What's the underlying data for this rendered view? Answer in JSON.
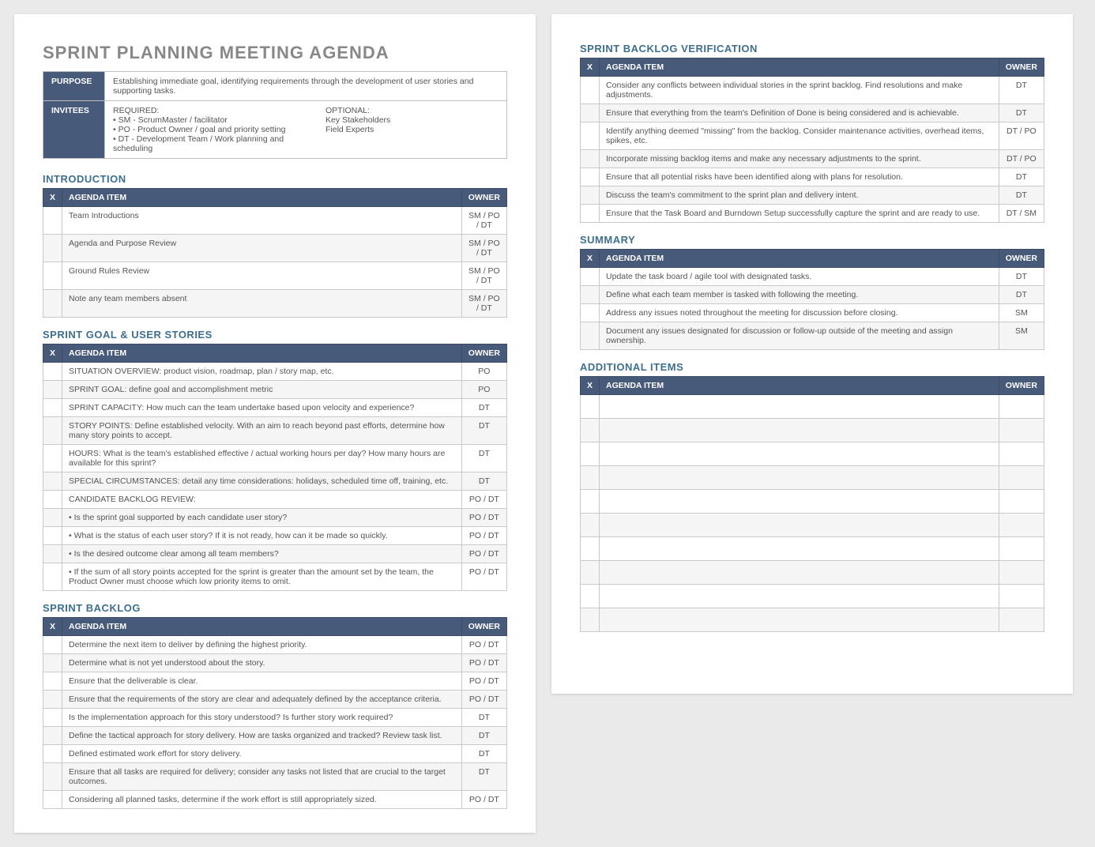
{
  "title": "SPRINT PLANNING MEETING AGENDA",
  "meta": {
    "purpose_label": "PURPOSE",
    "purpose_text": "Establishing immediate goal, identifying requirements through the development of user stories and supporting tasks.",
    "invitees_label": "INVITEES",
    "required_header": "REQUIRED:",
    "required_1": "• SM - ScrumMaster / facilitator",
    "required_2": "• PO - Product Owner / goal and priority setting",
    "required_3": "• DT - Development Team / Work planning and scheduling",
    "optional_header": "OPTIONAL:",
    "optional_1": "Key Stakeholders",
    "optional_2": "Field Experts"
  },
  "headers": {
    "x": "X",
    "item": "AGENDA ITEM",
    "owner": "OWNER"
  },
  "sections": {
    "introduction": {
      "title": "INTRODUCTION",
      "rows": [
        {
          "item": "Team Introductions",
          "owner": "SM / PO / DT"
        },
        {
          "item": "Agenda and Purpose Review",
          "owner": "SM / PO / DT"
        },
        {
          "item": "Ground Rules Review",
          "owner": "SM / PO / DT"
        },
        {
          "item": "Note any team members absent",
          "owner": "SM / PO / DT"
        }
      ]
    },
    "goal": {
      "title": "SPRINT GOAL & USER STORIES",
      "rows": [
        {
          "item": "SITUATION OVERVIEW: product vision, roadmap, plan / story map, etc.",
          "owner": "PO"
        },
        {
          "item": "SPRINT GOAL: define goal and accomplishment metric",
          "owner": "PO"
        },
        {
          "item": "SPRINT CAPACITY: How much can the team undertake based upon velocity and experience?",
          "owner": "DT"
        },
        {
          "item": "STORY POINTS: Define established velocity. With an aim to reach beyond past efforts, determine how many story points to accept.",
          "owner": "DT"
        },
        {
          "item": "HOURS: What is the team's established effective / actual working hours per day? How many hours are available for this sprint?",
          "owner": "DT"
        },
        {
          "item": "SPECIAL CIRCUMSTANCES: detail any time considerations: holidays, scheduled time off, training, etc.",
          "owner": "DT"
        },
        {
          "item": "CANDIDATE BACKLOG REVIEW:",
          "owner": "PO / DT"
        },
        {
          "item": "• Is the sprint goal supported by each candidate user story?",
          "owner": "PO / DT"
        },
        {
          "item": "• What is the status of each user story? If it is not ready, how can it be made so quickly.",
          "owner": "PO / DT"
        },
        {
          "item": "• Is the desired outcome clear among all team members?",
          "owner": "PO / DT"
        },
        {
          "item": "• If the sum of all story points accepted for the sprint is greater than the amount set by the team, the Product Owner must choose which low priority items to omit.",
          "owner": "PO / DT"
        }
      ]
    },
    "backlog": {
      "title": "SPRINT BACKLOG",
      "rows": [
        {
          "item": "Determine the next item to deliver by defining the highest priority.",
          "owner": "PO / DT"
        },
        {
          "item": "Determine what is not yet understood about the story.",
          "owner": "PO / DT"
        },
        {
          "item": "Ensure that the deliverable is clear.",
          "owner": "PO / DT"
        },
        {
          "item": "Ensure that the requirements of the story are clear and adequately defined by the acceptance criteria.",
          "owner": "PO / DT"
        },
        {
          "item": "Is the implementation approach for this story understood?  Is further story work required?",
          "owner": "DT"
        },
        {
          "item": "Define the tactical approach for story delivery.  How are tasks organized and tracked? Review task list.",
          "owner": "DT"
        },
        {
          "item": "Defined estimated work effort for story delivery.",
          "owner": "DT"
        },
        {
          "item": "Ensure that all tasks are required for delivery; consider any tasks not listed that are crucial to the target outcomes.",
          "owner": "DT"
        },
        {
          "item": "Considering all planned tasks, determine if the work effort is still appropriately sized.",
          "owner": "PO / DT"
        }
      ]
    },
    "verification": {
      "title": "SPRINT BACKLOG VERIFICATION",
      "rows": [
        {
          "item": "Consider any conflicts between individual stories in the sprint backlog. Find resolutions and make adjustments.",
          "owner": "DT"
        },
        {
          "item": "Ensure that everything from the team's Definition of Done is being considered and is achievable.",
          "owner": "DT"
        },
        {
          "item": "Identify anything deemed \"missing\" from the backlog. Consider maintenance activities, overhead items, spikes, etc.",
          "owner": "DT / PO"
        },
        {
          "item": "Incorporate missing backlog items and make any necessary adjustments to the sprint.",
          "owner": "DT / PO"
        },
        {
          "item": "Ensure that all potential risks have been identified along with plans for resolution.",
          "owner": "DT"
        },
        {
          "item": "Discuss the team's commitment to the sprint plan and delivery intent.",
          "owner": "DT"
        },
        {
          "item": "Ensure that the Task Board and Burndown Setup successfully capture the sprint and are ready to use.",
          "owner": "DT / SM"
        }
      ]
    },
    "summary": {
      "title": "SUMMARY",
      "rows": [
        {
          "item": "Update the task board / agile tool with designated tasks.",
          "owner": "DT"
        },
        {
          "item": "Define what each team member is tasked with following the meeting.",
          "owner": "DT"
        },
        {
          "item": "Address any issues noted throughout the meeting for discussion before closing.",
          "owner": "SM"
        },
        {
          "item": "Document any issues designated for discussion or follow-up outside of the meeting and assign ownership.",
          "owner": "SM"
        }
      ]
    },
    "additional": {
      "title": "ADDITIONAL ITEMS",
      "rows": [
        {
          "item": "",
          "owner": ""
        },
        {
          "item": "",
          "owner": ""
        },
        {
          "item": "",
          "owner": ""
        },
        {
          "item": "",
          "owner": ""
        },
        {
          "item": "",
          "owner": ""
        },
        {
          "item": "",
          "owner": ""
        },
        {
          "item": "",
          "owner": ""
        },
        {
          "item": "",
          "owner": ""
        },
        {
          "item": "",
          "owner": ""
        },
        {
          "item": "",
          "owner": ""
        }
      ]
    }
  }
}
